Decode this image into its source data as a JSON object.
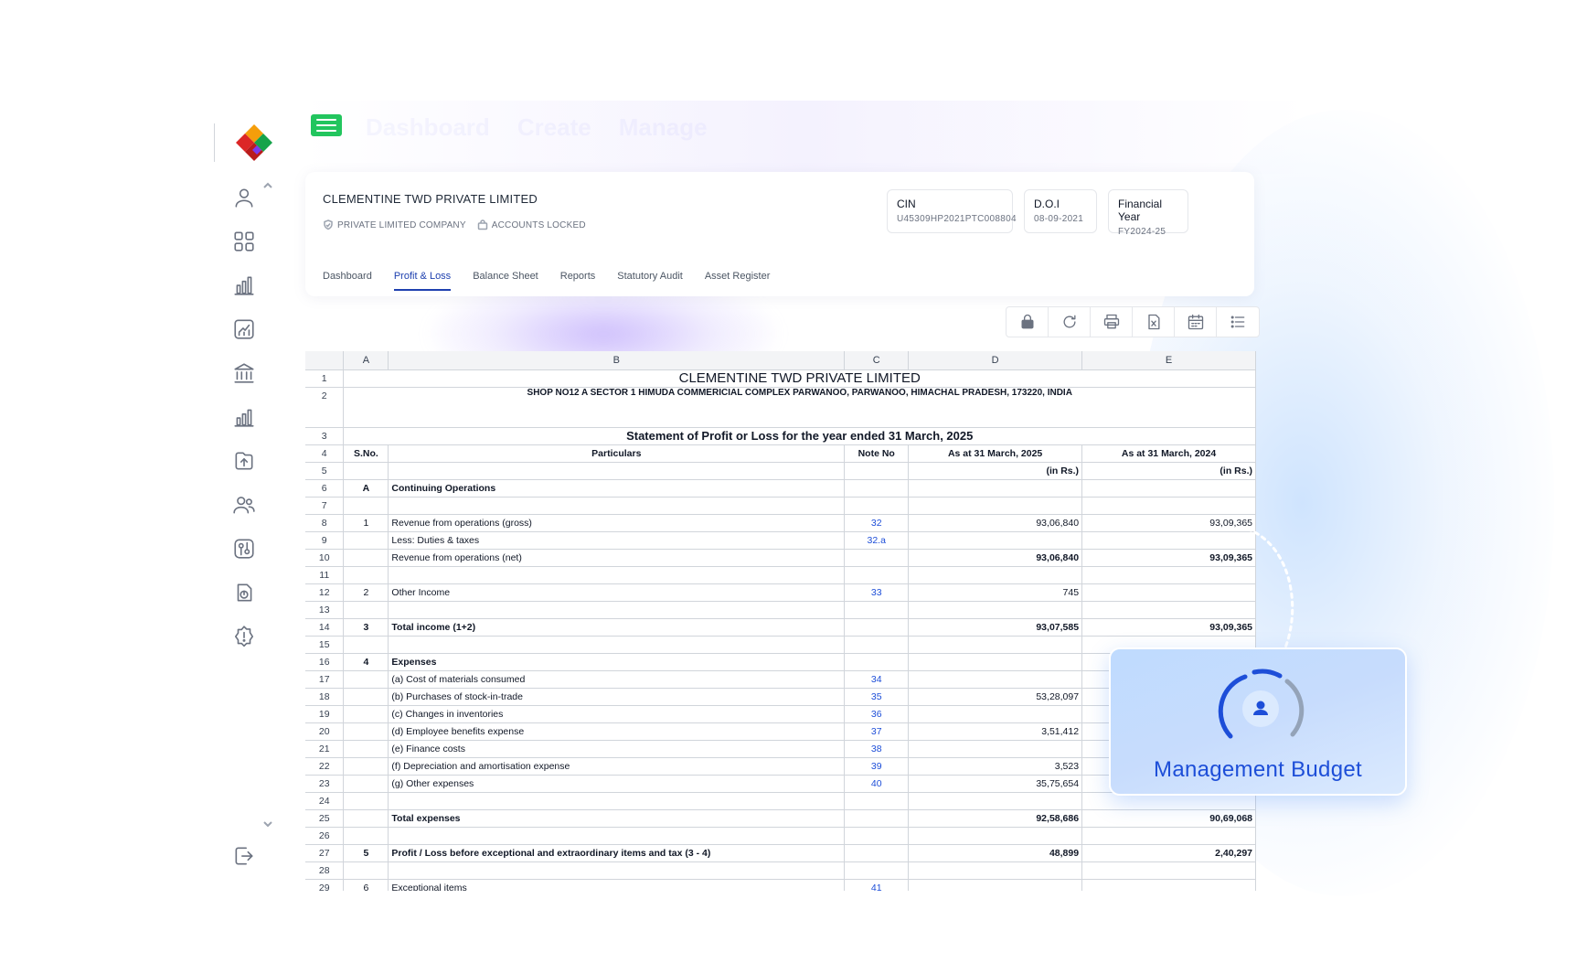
{
  "company": {
    "name": "CLEMENTINE TWD PRIVATE LIMITED",
    "badges": [
      "PRIVATE LIMITED COMPANY",
      "ACCOUNTS LOCKED"
    ],
    "info": [
      {
        "label": "CIN",
        "value": "U45309HP2021PTC008804"
      },
      {
        "label": "D.O.I",
        "value": "08-09-2021"
      },
      {
        "label": "Financial Year",
        "value": "FY2024-25"
      }
    ],
    "tabs": [
      "Dashboard",
      "Profit & Loss",
      "Balance Sheet",
      "Reports",
      "Statutory Audit",
      "Asset Register"
    ],
    "active_tab": "Profit & Loss"
  },
  "nav_faded": [
    "Dashboard",
    "Create",
    "Manage"
  ],
  "sheet": {
    "columns": [
      "",
      "A",
      "B",
      "C",
      "D",
      "E"
    ],
    "title": "CLEMENTINE TWD PRIVATE LIMITED",
    "address": "SHOP NO12 A SECTOR 1 HIMUDA COMMERICIAL COMPLEX PARWANOO, PARWANOO, HIMACHAL PRADESH, 173220, INDIA",
    "statement": "Statement of Profit or Loss for the year ended 31 March, 2025",
    "header": {
      "sno": "S.No.",
      "particulars": "Particulars",
      "note": "Note No",
      "cy": "As at 31 March, 2025",
      "py": "As at 31 March, 2024"
    },
    "unit": "(in Rs.)",
    "rows": [
      {
        "n": "6",
        "a": "A",
        "b": "Continuing Operations",
        "c": "",
        "d": "",
        "e": "",
        "bold": true
      },
      {
        "n": "7",
        "a": "",
        "b": "",
        "c": "",
        "d": "",
        "e": ""
      },
      {
        "n": "8",
        "a": "1",
        "b": "Revenue from operations (gross)",
        "c": "32",
        "d": "93,06,840",
        "e": "93,09,365"
      },
      {
        "n": "9",
        "a": "",
        "b": "Less: Duties & taxes",
        "c": "32.a",
        "d": "",
        "e": ""
      },
      {
        "n": "10",
        "a": "",
        "b": "Revenue from operations (net)",
        "c": "",
        "d": "93,06,840",
        "e": "93,09,365",
        "boldnum": true,
        "line": true
      },
      {
        "n": "11",
        "a": "",
        "b": "",
        "c": "",
        "d": "",
        "e": ""
      },
      {
        "n": "12",
        "a": "2",
        "b": "Other Income",
        "c": "33",
        "d": "745",
        "e": ""
      },
      {
        "n": "13",
        "a": "",
        "b": "",
        "c": "",
        "d": "",
        "e": ""
      },
      {
        "n": "14",
        "a": "3",
        "b": "Total income (1+2)",
        "c": "",
        "d": "93,07,585",
        "e": "93,09,365",
        "bold": true,
        "line": true
      },
      {
        "n": "15",
        "a": "",
        "b": "",
        "c": "",
        "d": "",
        "e": ""
      },
      {
        "n": "16",
        "a": "4",
        "b": "Expenses",
        "c": "",
        "d": "",
        "e": "",
        "bold": true
      },
      {
        "n": "17",
        "a": "",
        "b": "(a) Cost of materials consumed",
        "c": "34",
        "d": "",
        "e": "",
        "indent": true
      },
      {
        "n": "18",
        "a": "",
        "b": "(b) Purchases of stock-in-trade",
        "c": "35",
        "d": "53,28,097",
        "e": "",
        "indent": true
      },
      {
        "n": "19",
        "a": "",
        "b": "(c) Changes in inventories",
        "c": "36",
        "d": "",
        "e": "",
        "indent": true
      },
      {
        "n": "20",
        "a": "",
        "b": "(d) Employee benefits expense",
        "c": "37",
        "d": "3,51,412",
        "e": "",
        "indent": true
      },
      {
        "n": "21",
        "a": "",
        "b": "(e) Finance costs",
        "c": "38",
        "d": "",
        "e": "",
        "indent": true
      },
      {
        "n": "22",
        "a": "",
        "b": "(f) Depreciation and amortisation expense",
        "c": "39",
        "d": "3,523",
        "e": "",
        "indent": true
      },
      {
        "n": "23",
        "a": "",
        "b": "(g) Other expenses",
        "c": "40",
        "d": "35,75,654",
        "e": "",
        "indent": true
      },
      {
        "n": "24",
        "a": "",
        "b": "",
        "c": "",
        "d": "",
        "e": ""
      },
      {
        "n": "25",
        "a": "",
        "b": "Total expenses",
        "c": "",
        "d": "92,58,686",
        "e": "90,69,068",
        "bold": true,
        "line": true
      },
      {
        "n": "26",
        "a": "",
        "b": "",
        "c": "",
        "d": "",
        "e": ""
      },
      {
        "n": "27",
        "a": "5",
        "b": "Profit / Loss before exceptional and extraordinary items and tax (3 - 4)",
        "c": "",
        "d": "48,899",
        "e": "2,40,297",
        "bold": true
      },
      {
        "n": "28",
        "a": "",
        "b": "",
        "c": "",
        "d": "",
        "e": ""
      },
      {
        "n": "29",
        "a": "6",
        "b": "Exceptional items",
        "c": "41",
        "d": "",
        "e": ""
      }
    ]
  },
  "toolbar_icons": [
    "lock-icon",
    "refresh-icon",
    "print-icon",
    "excel-export-icon",
    "calendar-icon",
    "list-icon"
  ],
  "sidebar_icons": [
    "user-icon",
    "apps-grid-icon",
    "bar-chart-icon",
    "trend-chart-icon",
    "bank-icon",
    "analytics-icon",
    "upload-icon",
    "users-icon",
    "settings-panel-icon",
    "reports-pie-icon",
    "alert-badge-icon",
    "logout-icon"
  ],
  "overlay": {
    "label": "Management Budget"
  },
  "colors": {
    "accent": "#1d4ed8",
    "menu_green": "#22c55e",
    "overlay_bg": "#bfdbfe"
  }
}
